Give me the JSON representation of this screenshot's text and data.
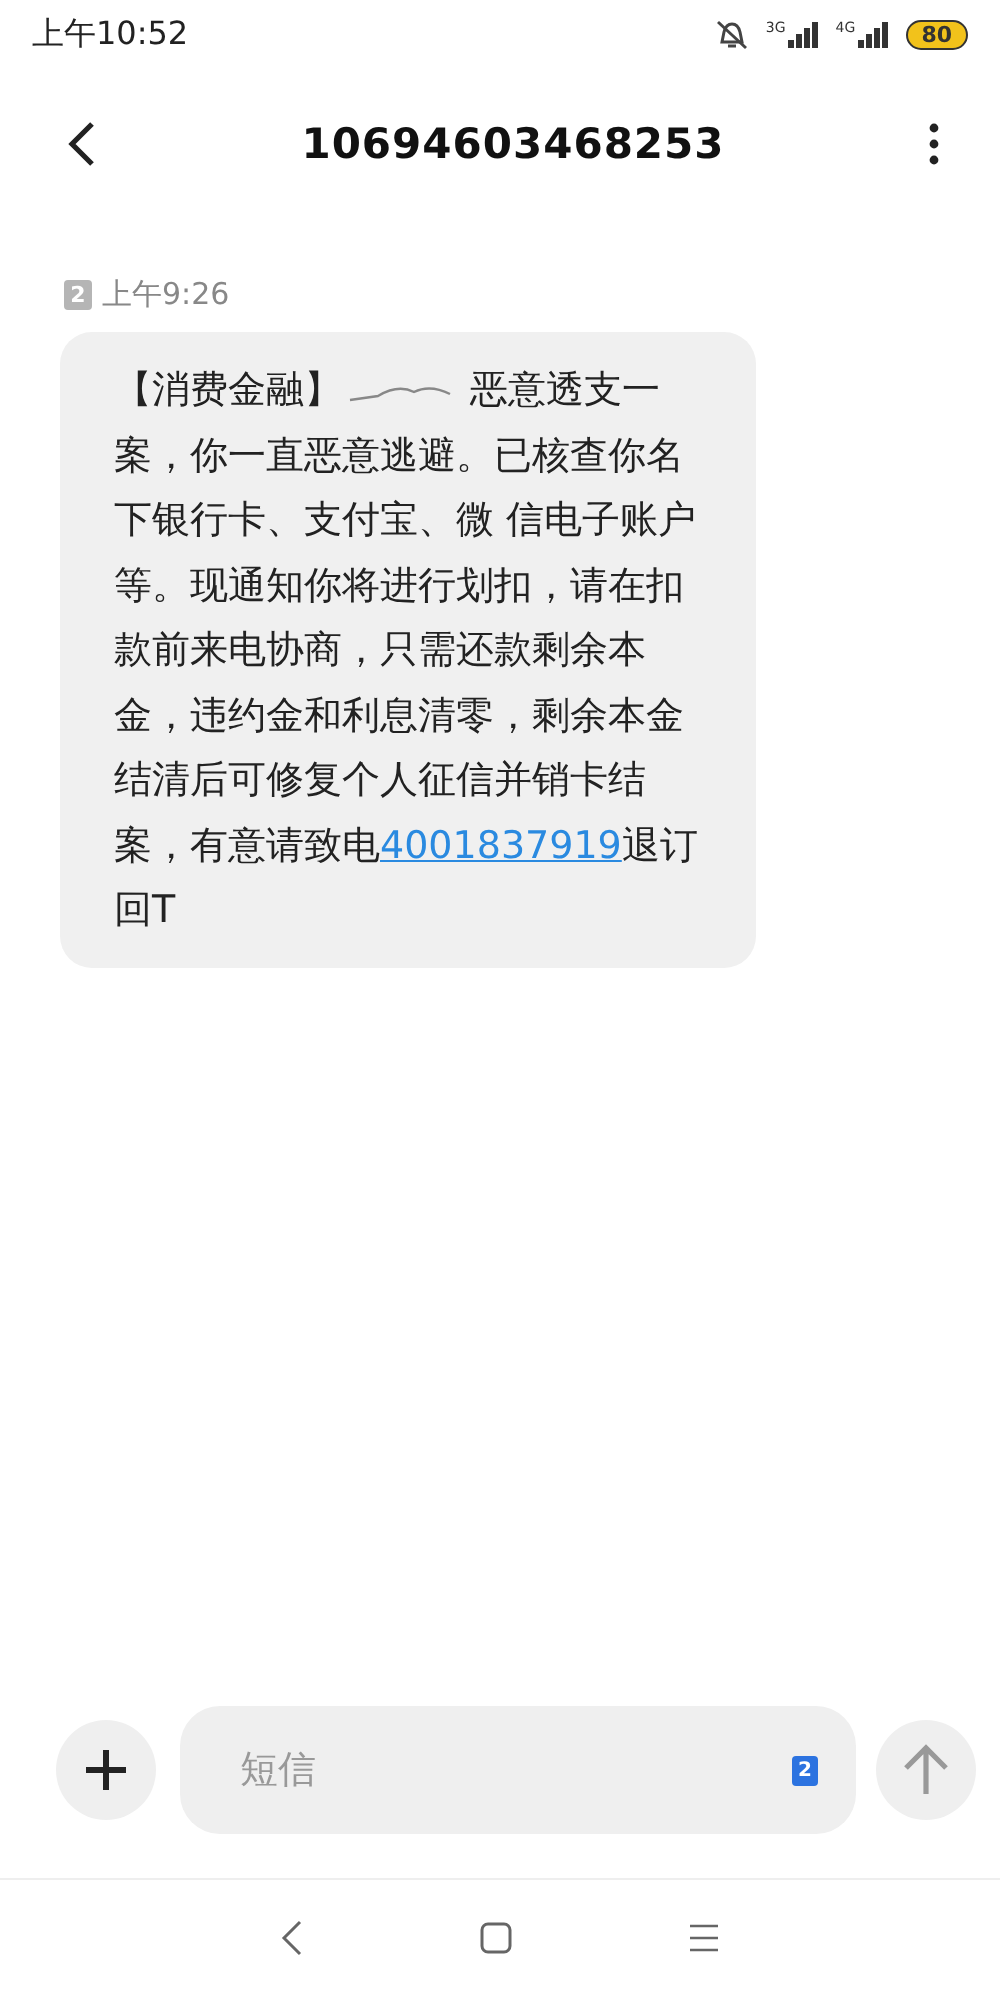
{
  "status_bar": {
    "time": "上午10:52",
    "networks": [
      {
        "label": "3G"
      },
      {
        "label": "4G"
      }
    ],
    "battery": "80"
  },
  "header": {
    "title": "10694603468253"
  },
  "messages": [
    {
      "sim": "2",
      "time": "上午9:26",
      "parts": [
        {
          "kind": "text",
          "text": "【消费金融】"
        },
        {
          "kind": "redaction"
        },
        {
          "kind": "text",
          "text": "恶意透支一案，你一直恶意逃避。已核查你名下银行卡、支付宝、微 信电子账户等。现通知你将进行划扣，请在扣款前来电协商，只需还款剩余本金，违约金和利息清零，剩余本金结清后可修复个人征信并销卡结案，有意请致电"
        },
        {
          "kind": "link",
          "text": "4001837919"
        },
        {
          "kind": "text",
          "text": "退订回T"
        }
      ]
    }
  ],
  "composer": {
    "placeholder": "短信",
    "sim": "2",
    "send_disabled": true
  }
}
